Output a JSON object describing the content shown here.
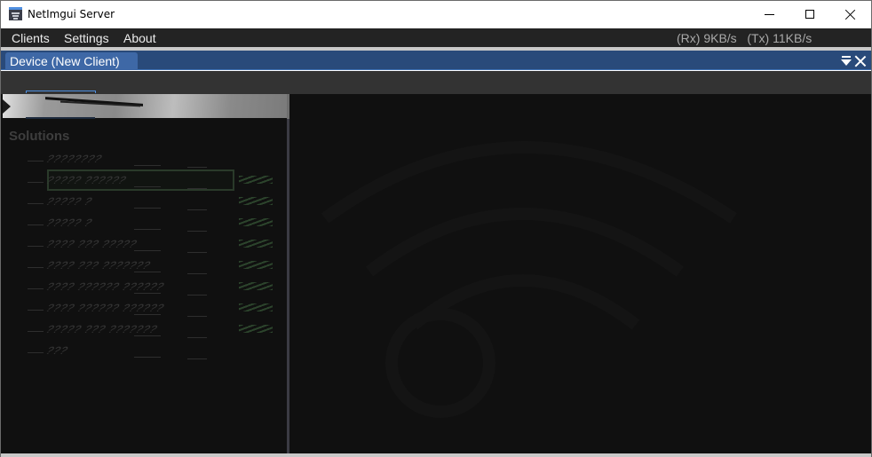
{
  "window": {
    "title": "NetImgui Server",
    "icon": "netimgui-app-icon",
    "controls": [
      "minimize",
      "maximize",
      "close"
    ]
  },
  "menubar": {
    "items": [
      {
        "label": "Clients"
      },
      {
        "label": "Settings"
      },
      {
        "label": "About"
      }
    ],
    "net_stats": "(Rx) 9KB/s   (Tx) 11KB/s"
  },
  "dock": {
    "tabs": [
      {
        "label": "Device (New Client)",
        "active": true
      }
    ],
    "tab_menu_icon": "dock-menu-icon",
    "tab_close_icon": "close-icon"
  },
  "remote_client": {
    "section_title": "Solutions",
    "rows": [
      {
        "label": "????????"
      },
      {
        "label": "????? ??????"
      },
      {
        "label": "????? ?"
      },
      {
        "label": "????? ?"
      },
      {
        "label": "???? ??? ?????"
      },
      {
        "label": "???? ??? ???????"
      },
      {
        "label": "???? ?????? ??????"
      },
      {
        "label": "???? ?????? ??????"
      },
      {
        "label": "????? ??? ???????"
      },
      {
        "label": "???"
      }
    ],
    "render_state": "corrupted"
  },
  "colors": {
    "tab_bar": "#294a7a",
    "tab_active": "#3e68a6",
    "menubar_bg": "#232323",
    "panel_bg": "#101010",
    "accent_blue": "#4f8fe0"
  }
}
